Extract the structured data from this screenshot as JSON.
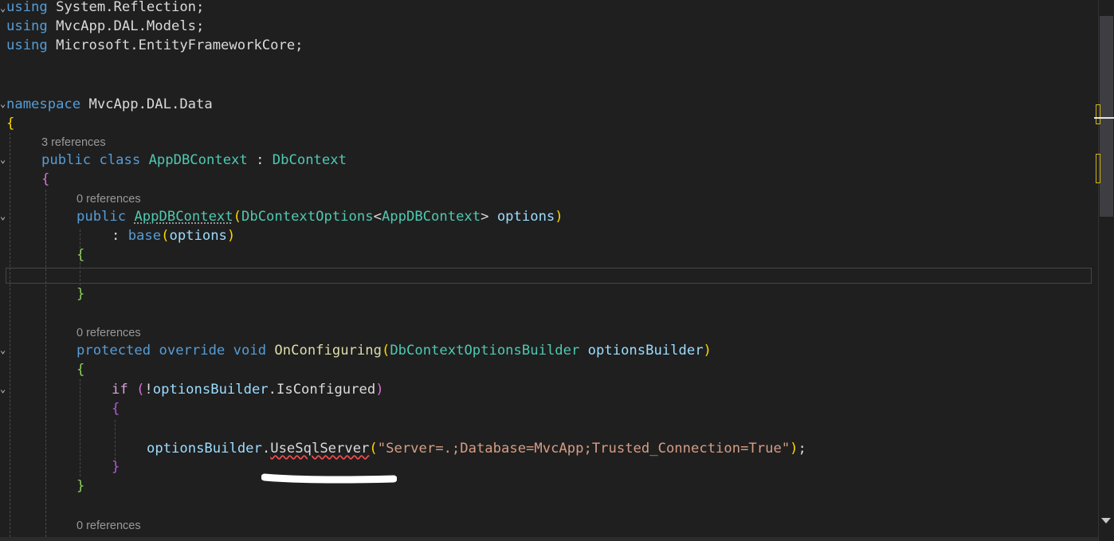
{
  "code": {
    "l1_kw": "using",
    "l1_rest": " System.Reflection;",
    "l2_kw": "using",
    "l2_rest": " MvcApp.DAL.Models;",
    "l3_kw": "using",
    "l3_rest": " Microsoft.EntityFrameworkCore;",
    "ns_kw": "namespace",
    "ns_name": " MvcApp.DAL.Data",
    "open_brace": "{",
    "class_refs": "3 references",
    "class_public": "public",
    "class_kw": "class",
    "class_name": "AppDBContext",
    "class_colon": " : ",
    "class_base": "DbContext",
    "ctor_refs": "0 references",
    "ctor_public": "public",
    "ctor_name": "AppDBContext",
    "ctor_paren_open": "(",
    "ctor_param_type": "DbContextOptions",
    "ctor_lt": "<",
    "ctor_generic": "AppDBContext",
    "ctor_gt": "> ",
    "ctor_param": "options",
    "ctor_paren_close": ")",
    "base_colon": ": ",
    "base_kw": "base",
    "base_open": "(",
    "base_arg": "options",
    "base_close": ")",
    "ctor_brace_open": "{",
    "ctor_brace_close": "}",
    "method_refs": "0 references",
    "m_protected": "protected",
    "m_override": "override",
    "m_void": "void",
    "m_name": "OnConfiguring",
    "m_open": "(",
    "m_param_type": "DbContextOptionsBuilder",
    "m_param": "optionsBuilder",
    "m_close": ")",
    "m_brace_open": "{",
    "if_kw": "if",
    "if_open": "(",
    "if_not": "!",
    "if_obj": "optionsBuilder",
    "if_dot": ".",
    "if_prop": "IsConfigured",
    "if_close": ")",
    "if_brace_open": "{",
    "call_obj": "optionsBuilder",
    "call_dot": ".",
    "call_method": "UseSqlServer",
    "call_open": "(",
    "call_str": "\"Server=.;Database=MvcApp;Trusted_Connection=True\"",
    "call_close": ")",
    "call_semi": ";",
    "if_brace_close": "}",
    "m_brace_close": "}",
    "next_refs": "0 references"
  }
}
